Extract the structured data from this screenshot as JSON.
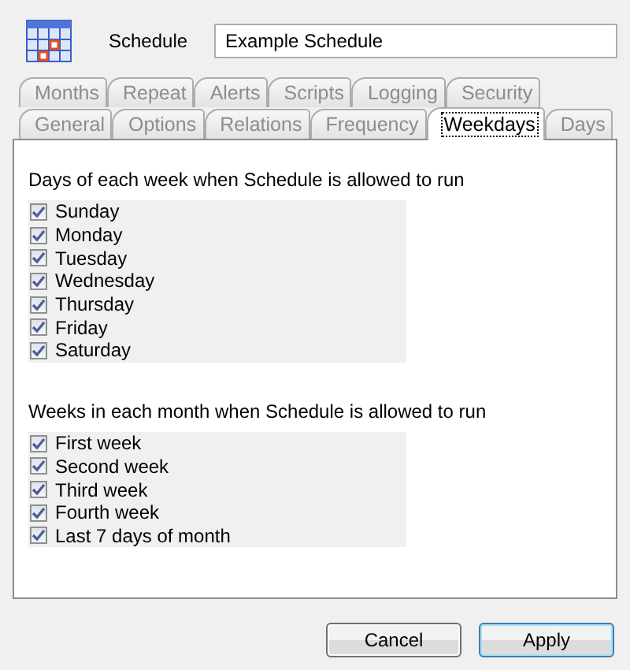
{
  "header": {
    "label": "Schedule",
    "value": "Example Schedule"
  },
  "tab_rows": [
    [
      {
        "label": "Months",
        "selected": false
      },
      {
        "label": "Repeat",
        "selected": false
      },
      {
        "label": "Alerts",
        "selected": false
      },
      {
        "label": "Scripts",
        "selected": false
      },
      {
        "label": "Logging",
        "selected": false
      },
      {
        "label": "Security",
        "selected": false
      }
    ],
    [
      {
        "label": "General",
        "selected": false
      },
      {
        "label": "Options",
        "selected": false
      },
      {
        "label": "Relations",
        "selected": false
      },
      {
        "label": "Frequency",
        "selected": false
      },
      {
        "label": "Weekdays",
        "selected": true
      },
      {
        "label": "Days",
        "selected": false
      }
    ]
  ],
  "sections": [
    {
      "heading": "Days of each week when Schedule is allowed to run",
      "items": [
        {
          "label": "Sunday",
          "checked": true
        },
        {
          "label": "Monday",
          "checked": true
        },
        {
          "label": "Tuesday",
          "checked": true
        },
        {
          "label": "Wednesday",
          "checked": true
        },
        {
          "label": "Thursday",
          "checked": true
        },
        {
          "label": "Friday",
          "checked": true
        },
        {
          "label": "Saturday",
          "checked": true
        }
      ]
    },
    {
      "heading": "Weeks in each month when Schedule is allowed to run",
      "items": [
        {
          "label": "First week",
          "checked": true
        },
        {
          "label": "Second week",
          "checked": true
        },
        {
          "label": "Third week",
          "checked": true
        },
        {
          "label": "Fourth week",
          "checked": true
        },
        {
          "label": "Last 7 days of month",
          "checked": true
        }
      ]
    }
  ],
  "buttons": [
    {
      "label": "Cancel",
      "default": false
    },
    {
      "label": "Apply",
      "default": true
    }
  ]
}
